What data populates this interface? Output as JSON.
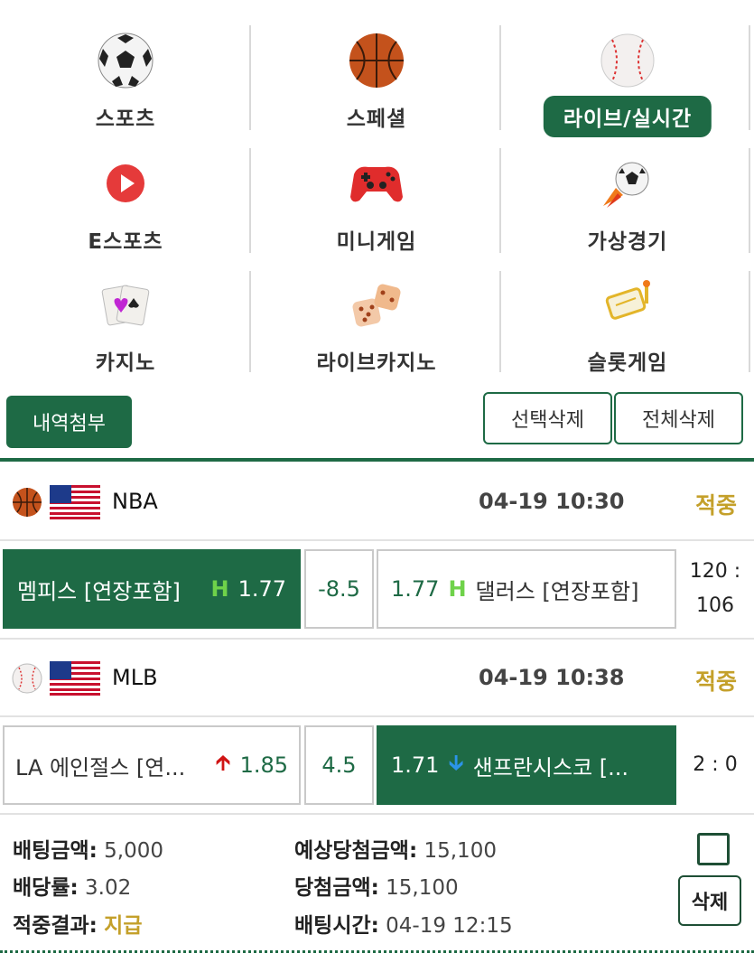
{
  "categories": [
    {
      "label": "스포츠",
      "icon": "soccer-ball-icon",
      "active": false
    },
    {
      "label": "스페셜",
      "icon": "basketball-icon",
      "active": false
    },
    {
      "label": "라이브/실시간",
      "icon": "baseball-icon",
      "active": true
    },
    {
      "label": "E스포츠",
      "icon": "play-button-icon",
      "active": false
    },
    {
      "label": "미니게임",
      "icon": "gamepad-icon",
      "active": false
    },
    {
      "label": "가상경기",
      "icon": "rocket-ball-icon",
      "active": false
    },
    {
      "label": "카지노",
      "icon": "playing-cards-icon",
      "active": false
    },
    {
      "label": "라이브카지노",
      "icon": "dice-icon",
      "active": false
    },
    {
      "label": "슬롯게임",
      "icon": "slot-reel-icon",
      "active": false
    }
  ],
  "actions": {
    "attach": "내역첨부",
    "delete_selected": "선택삭제",
    "delete_all": "전체삭제"
  },
  "games": [
    {
      "league": "NBA",
      "ball_icon": "basketball-icon",
      "flag_icon": "us-flag-icon",
      "time": "04-19 10:30",
      "status": "적중",
      "home": {
        "team": "멤피스 [연장포함]",
        "mark": "H",
        "odds": "1.77",
        "selected": true
      },
      "handicap": "-8.5",
      "away": {
        "odds": "1.77",
        "mark": "H",
        "team": "댈러스 [연장포함]",
        "selected": false
      },
      "score_home": "120",
      "score_away": "106"
    },
    {
      "league": "MLB",
      "ball_icon": "baseball-icon",
      "flag_icon": "us-flag-icon",
      "time": "04-19 10:38",
      "status": "적중",
      "home": {
        "team": "LA 에인절스 [연...",
        "mark": "up-arrow",
        "odds": "1.85",
        "selected": false
      },
      "handicap": "4.5",
      "away": {
        "odds": "1.71",
        "mark": "down-arrow",
        "team": "샌프란시스코 [...",
        "selected": true
      },
      "score_home": "2",
      "score_away": "0"
    }
  ],
  "summary": {
    "bet_amount_label": "배팅금액",
    "bet_amount": "5,000",
    "odds_label": "배당률",
    "odds": "3.02",
    "result_label": "적중결과",
    "result": "지급",
    "expected_label": "예상당첨금액",
    "expected": "15,100",
    "win_label": "당첨금액",
    "win": "15,100",
    "time_label": "배팅시간",
    "time": "04-19 12:15",
    "delete_label": "삭제"
  },
  "colors": {
    "primary": "#1e6a45",
    "gold": "#c4a02a",
    "up": "#d01414",
    "down": "#2b94e8"
  }
}
